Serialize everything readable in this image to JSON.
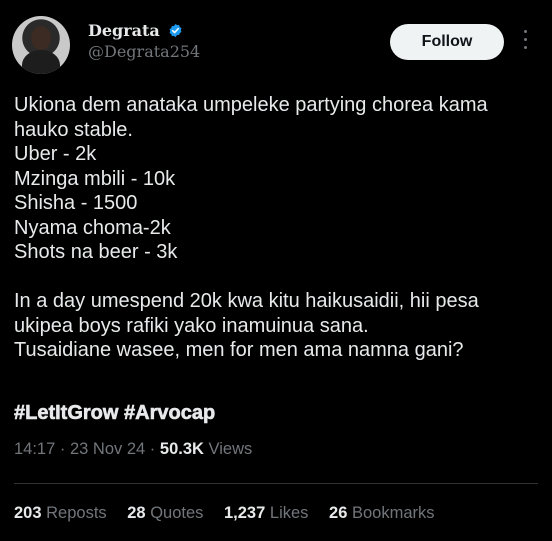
{
  "author": {
    "display_name": "Degrata",
    "handle": "@Degrata254",
    "verified": true
  },
  "header": {
    "follow_label": "Follow"
  },
  "post": {
    "text": "Ukiona dem anataka umpeleke partying chorea kama\nhauko stable.\nUber - 2k\nMzinga mbili - 10k\nShisha - 1500\nNyama choma-2k\nShots na beer - 3k\n\nIn a day umespend 20k kwa kitu haikusaidii, hii pesa\nukipea boys rafiki yako inamuinua sana.\nTusaidiane  wasee, men for men ama namna gani?",
    "hashtags": [
      "#LetItGrow",
      "#Arvocap"
    ]
  },
  "meta": {
    "time": "14:17",
    "date": "23 Nov 24",
    "views_count": "50.3K",
    "views_label": "Views"
  },
  "stats": {
    "reposts_count": "203",
    "reposts_label": "Reposts",
    "quotes_count": "28",
    "quotes_label": "Quotes",
    "likes_count": "1,237",
    "likes_label": "Likes",
    "bookmarks_count": "26",
    "bookmarks_label": "Bookmarks"
  },
  "colors": {
    "background": "#000000",
    "text": "#e7e9ea",
    "muted": "#71767b",
    "verified_badge": "#1d9bf0",
    "follow_button_bg": "#eff3f4"
  },
  "icons": [
    "verified-badge-icon",
    "more-options-icon"
  ]
}
